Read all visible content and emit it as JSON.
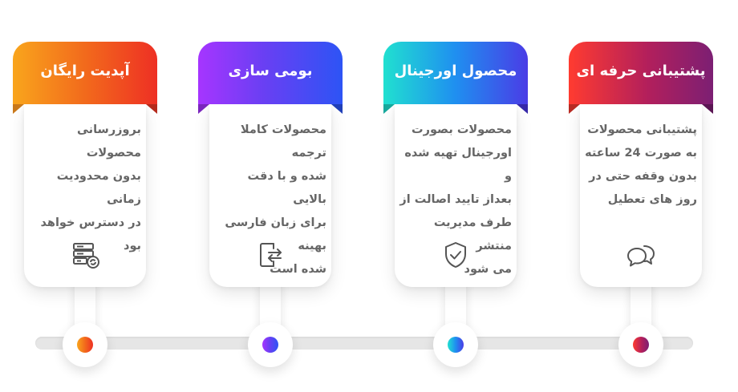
{
  "cards": [
    {
      "title": "آپدیت رایگان",
      "text": "بروزرسانی محصولات\nبدون محدودیت زمانی\nدر دسترس خواهد بود",
      "icon": "server-sync-icon",
      "accent": "#f26a1c"
    },
    {
      "title": "بومی سازی",
      "text": "محصولات کاملا ترجمه\nشده و با دقت بالایی\nبرای زبان فارسی بهینه\nشده است",
      "icon": "door-arrows-icon",
      "accent": "#6a3ff3"
    },
    {
      "title": "محصول اورجینال",
      "text": "محصولات بصورت\nاورجینال تهیه شده و\nبعداز تایید اصالت از\nطرف مدیریت منتشر\nمی شود",
      "icon": "shield-check-icon",
      "accent": "#1f8ff0"
    },
    {
      "title": "پشتیبانی حرفه ای",
      "text": "پشتیبانی محصولات\nبه صورت 24 ساعته\nبدون وقفه حتی در\nروز های تعطیل",
      "icon": "chat-bubbles-icon",
      "accent": "#b21f5c"
    }
  ]
}
